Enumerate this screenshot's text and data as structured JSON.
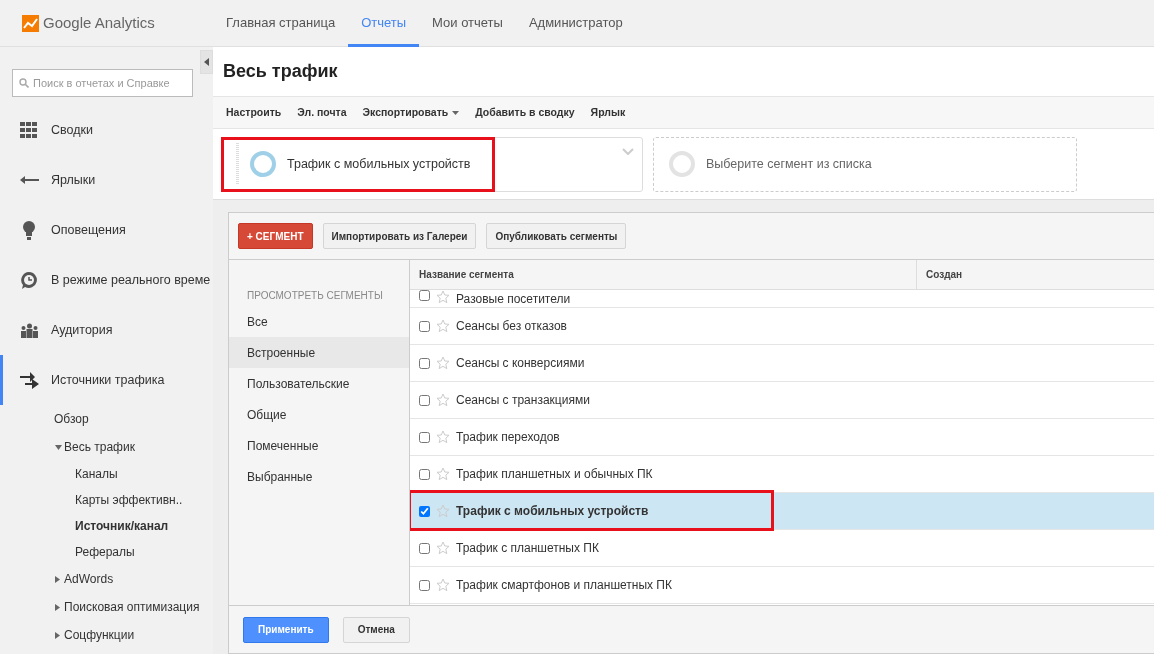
{
  "app": {
    "logo_text": "Google Analytics"
  },
  "top_nav": [
    {
      "label": "Главная страница",
      "selected": false
    },
    {
      "label": "Отчеты",
      "selected": true
    },
    {
      "label": "Мои отчеты",
      "selected": false
    },
    {
      "label": "Администратор",
      "selected": false
    }
  ],
  "sidebar": {
    "search": {
      "placeholder": "Поиск в отчетах и Справке"
    },
    "items": [
      {
        "label": "Сводки",
        "selected": false
      },
      {
        "label": "Ярлыки",
        "selected": false
      },
      {
        "label": "Оповещения",
        "selected": false
      },
      {
        "label": "В режиме реального време",
        "selected": false
      },
      {
        "label": "Аудитория",
        "selected": false
      },
      {
        "label": "Источники трафика",
        "selected": true,
        "children": [
          {
            "label": "Обзор",
            "selected": false
          },
          {
            "label": "Весь трафик",
            "selected": false,
            "expanded": true,
            "children": [
              {
                "label": "Каналы",
                "selected": false
              },
              {
                "label": "Карты эффективн..",
                "selected": false
              },
              {
                "label": "Источник/канал",
                "selected": true
              },
              {
                "label": "Рефералы",
                "selected": false
              }
            ]
          },
          {
            "label": "AdWords",
            "selected": false,
            "expanded": false
          },
          {
            "label": "Поисковая оптимизация",
            "selected": false,
            "expanded": false
          },
          {
            "label": "Соцфункции",
            "selected": false,
            "expanded": false
          }
        ]
      }
    ]
  },
  "report": {
    "title": "Весь трафик",
    "toolbar": [
      {
        "label": "Настроить",
        "kind": "plain"
      },
      {
        "label": "Эл. почта",
        "kind": "plain"
      },
      {
        "label": "Экспортировать",
        "kind": "dropdown"
      },
      {
        "label": "Добавить в сводку",
        "kind": "plain"
      },
      {
        "label": "Ярлык",
        "kind": "plain"
      }
    ],
    "segments": [
      {
        "label": "Трафик с мобильных устройств",
        "kind": "applied",
        "highlighted": true
      },
      {
        "label": "Выберите сегмент из списка",
        "kind": "empty",
        "highlighted": false
      }
    ]
  },
  "segment_picker": {
    "buttons": [
      {
        "label": "+ СЕГМЕНТ",
        "kind": "danger"
      },
      {
        "label": "Импортировать из Галереи",
        "kind": "default"
      },
      {
        "label": "Опубликовать сегменты",
        "kind": "default"
      }
    ],
    "filter_heading": "ПРОСМОТРЕТЬ СЕГМЕНТЫ",
    "filters": [
      {
        "label": "Все",
        "selected": false
      },
      {
        "label": "Встроенные",
        "selected": true
      },
      {
        "label": "Пользовательские",
        "selected": false
      },
      {
        "label": "Общие",
        "selected": false
      },
      {
        "label": "Помеченные",
        "selected": false
      },
      {
        "label": "Выбранные",
        "selected": false
      }
    ],
    "table": {
      "columns": [
        "Название сегмента",
        "Создан"
      ],
      "rows": [
        {
          "name": "Разовые посетители",
          "checked": false,
          "starred": false,
          "selected": false,
          "highlighted": false
        },
        {
          "name": "Сеансы без отказов",
          "checked": false,
          "starred": false,
          "selected": false,
          "highlighted": false
        },
        {
          "name": "Сеансы с конверсиями",
          "checked": false,
          "starred": false,
          "selected": false,
          "highlighted": false
        },
        {
          "name": "Сеансы с транзакциями",
          "checked": false,
          "starred": false,
          "selected": false,
          "highlighted": false
        },
        {
          "name": "Трафик переходов",
          "checked": false,
          "starred": false,
          "selected": false,
          "highlighted": false
        },
        {
          "name": "Трафик планшетных и обычных ПК",
          "checked": false,
          "starred": false,
          "selected": false,
          "highlighted": false
        },
        {
          "name": "Трафик с мобильных устройств",
          "checked": true,
          "starred": false,
          "selected": true,
          "highlighted": true
        },
        {
          "name": "Трафик с планшетных ПК",
          "checked": false,
          "starred": false,
          "selected": false,
          "highlighted": false
        },
        {
          "name": "Трафик смартфонов и планшетных ПК",
          "checked": false,
          "starred": false,
          "selected": false,
          "highlighted": false
        }
      ]
    },
    "footer_buttons": [
      {
        "label": "Применить",
        "kind": "primary"
      },
      {
        "label": "Отмена",
        "kind": "default"
      }
    ]
  }
}
